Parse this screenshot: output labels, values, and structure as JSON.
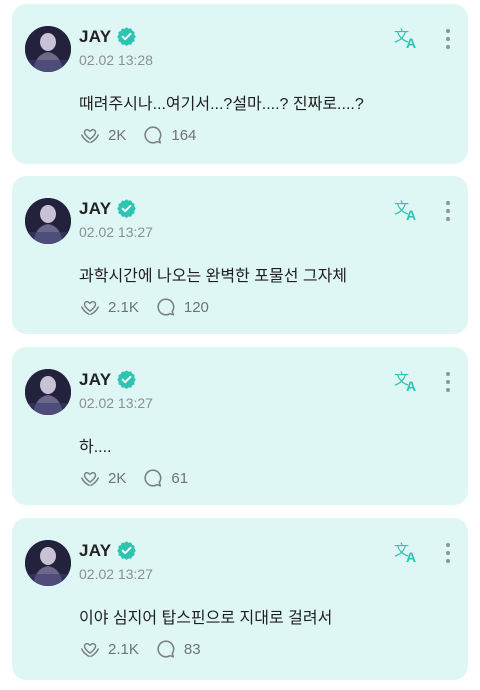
{
  "posts": [
    {
      "author": "JAY",
      "timestamp": "02.02 13:28",
      "text": "때려주시나...여기서...?설마....? 진짜로....?",
      "likes": "2K",
      "comments": "164"
    },
    {
      "author": "JAY",
      "timestamp": "02.02 13:27",
      "text": "과학시간에 나오는 완벽한 포물선 그자체",
      "likes": "2.1K",
      "comments": "120"
    },
    {
      "author": "JAY",
      "timestamp": "02.02 13:27",
      "text": "하....",
      "likes": "2K",
      "comments": "61"
    },
    {
      "author": "JAY",
      "timestamp": "02.02 13:27",
      "text": "이야 심지어 탑스핀으로 지대로 걸려서",
      "likes": "2.1K",
      "comments": "83"
    }
  ],
  "colors": {
    "card_background": "#dff7f4",
    "accent": "#2fc4b2",
    "verified_badge": "#2fc4b2"
  },
  "icons": {
    "verified": "verified-badge-icon",
    "translate": "translate-icon",
    "more": "more-vertical-icon",
    "like": "heart-hands-icon",
    "comment": "comment-bubble-icon"
  }
}
